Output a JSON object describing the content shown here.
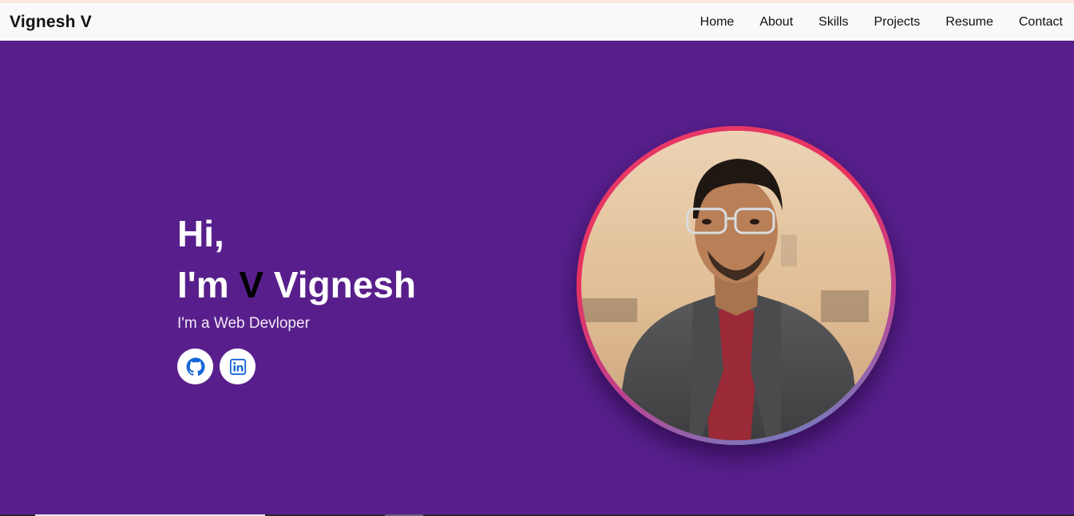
{
  "navbar": {
    "brand": "Vignesh V",
    "links": [
      "Home",
      "About",
      "Skills",
      "Projects",
      "Resume",
      "Contact"
    ]
  },
  "hero": {
    "greeting": "Hi,",
    "name_prefix": "I'm ",
    "name_initial": "V",
    "name_rest": " Vignesh",
    "tagline": "I'm a Web Devloper",
    "socials": [
      {
        "icon": "github-icon"
      },
      {
        "icon": "linkedin-icon"
      }
    ]
  },
  "colors": {
    "hero_background": "#581f8c",
    "navbar_background": "#f8f9fa",
    "social_icon": "#1565d8",
    "ring_gradient": [
      "#e83a6a",
      "#c0408e",
      "#5c8fd0"
    ]
  }
}
